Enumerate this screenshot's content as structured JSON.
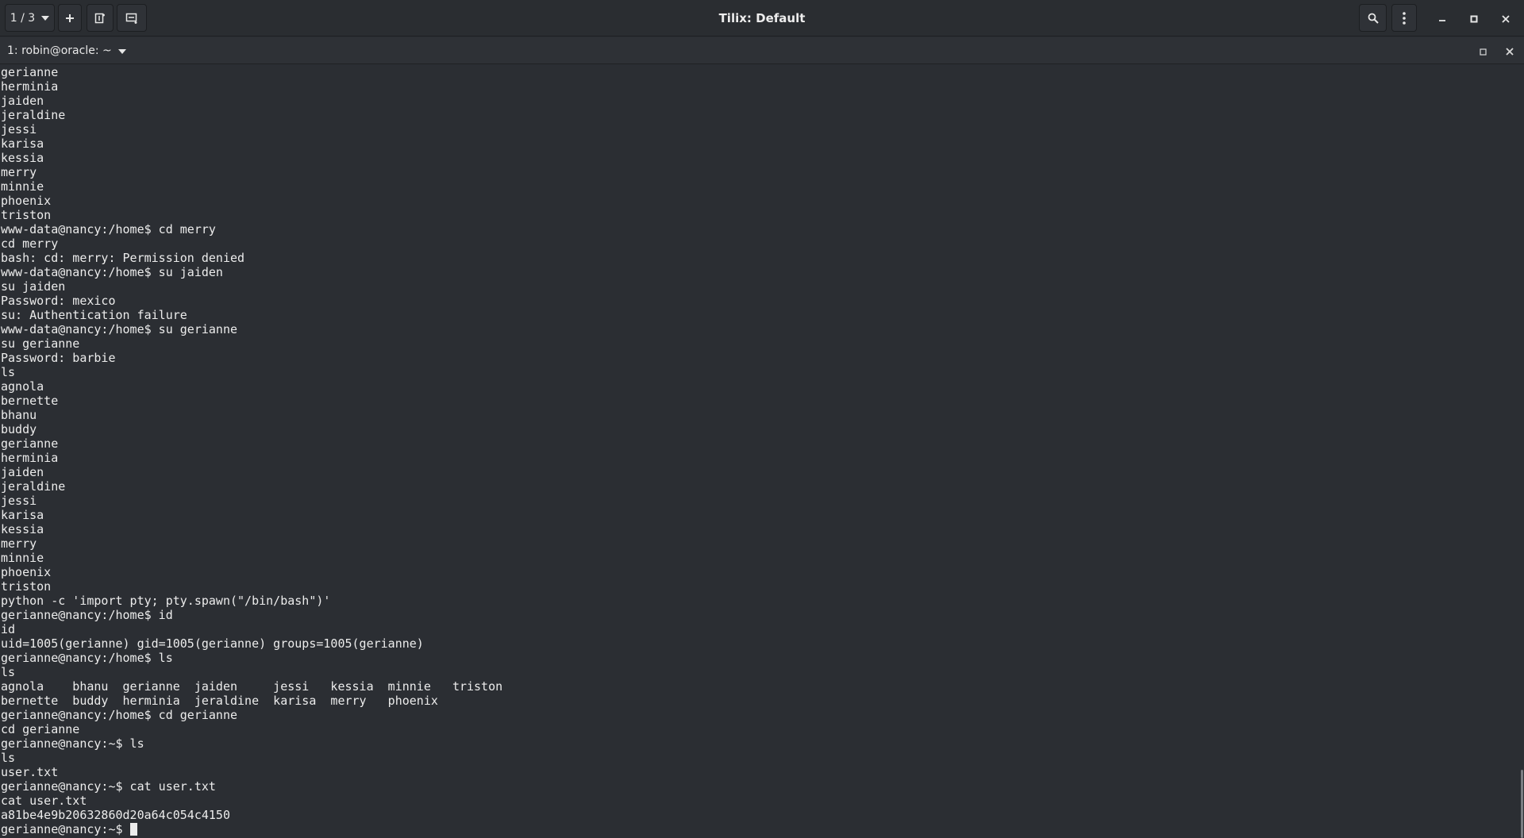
{
  "titlebar": {
    "session_switcher": "1 / 3",
    "title": "Tilix: Default"
  },
  "session": {
    "title": "1: robin@oracle: ~"
  },
  "icons": {
    "dropdown": "chevron-down-icon",
    "add": "plus-icon",
    "add_right": "split-right-icon",
    "add_down": "split-down-icon",
    "search": "search-icon",
    "menu": "kebab-menu-icon",
    "minimize": "minimize-icon",
    "maximize": "maximize-icon",
    "close": "close-icon"
  },
  "terminal": {
    "lines": [
      "gerianne",
      "herminia",
      "jaiden",
      "jeraldine",
      "jessi",
      "karisa",
      "kessia",
      "merry",
      "minnie",
      "phoenix",
      "triston",
      "www-data@nancy:/home$ cd merry",
      "cd merry",
      "bash: cd: merry: Permission denied",
      "www-data@nancy:/home$ su jaiden",
      "su jaiden",
      "Password: mexico",
      "su: Authentication failure",
      "www-data@nancy:/home$ su gerianne",
      "su gerianne",
      "Password: barbie",
      "ls",
      "agnola",
      "bernette",
      "bhanu",
      "buddy",
      "gerianne",
      "herminia",
      "jaiden",
      "jeraldine",
      "jessi",
      "karisa",
      "kessia",
      "merry",
      "minnie",
      "phoenix",
      "triston",
      "python -c 'import pty; pty.spawn(\"/bin/bash\")'",
      "gerianne@nancy:/home$ id",
      "id",
      "uid=1005(gerianne) gid=1005(gerianne) groups=1005(gerianne)",
      "gerianne@nancy:/home$ ls",
      "ls",
      "agnola    bhanu  gerianne  jaiden     jessi   kessia  minnie   triston",
      "bernette  buddy  herminia  jeraldine  karisa  merry   phoenix",
      "gerianne@nancy:/home$ cd gerianne",
      "cd gerianne",
      "gerianne@nancy:~$ ls",
      "ls",
      "user.txt",
      "gerianne@nancy:~$ cat user.txt",
      "cat user.txt",
      "a81be4e9b20632860d20a64c054c4150"
    ],
    "prompt": "gerianne@nancy:~$ "
  }
}
